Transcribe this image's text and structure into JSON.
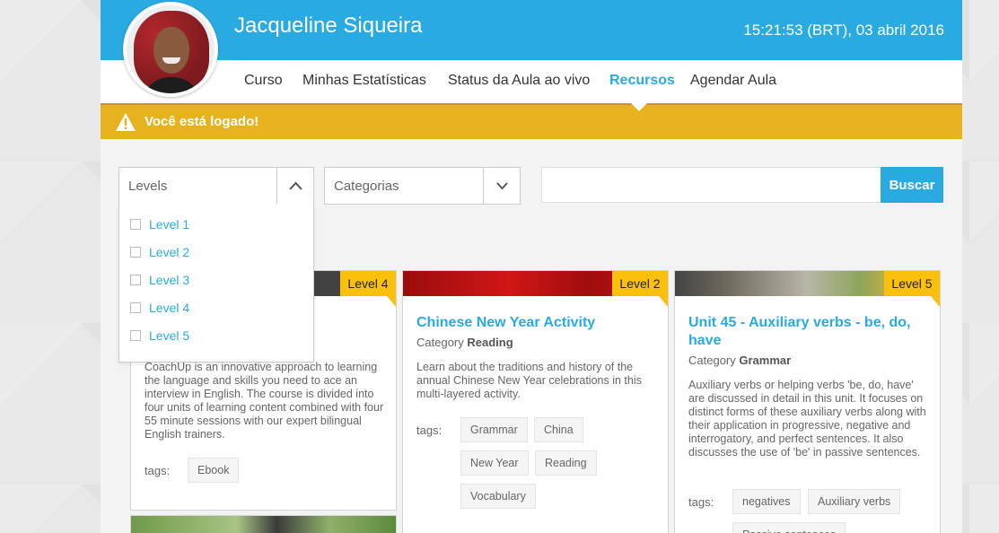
{
  "header": {
    "user_name": "Jacqueline Siqueira",
    "datetime": "15:21:53 (BRT), 03 abril 2016"
  },
  "nav": {
    "items": [
      {
        "label": "Curso"
      },
      {
        "label": "Minhas Estatísticas"
      },
      {
        "label": "Status da Aula ao vivo"
      },
      {
        "label": "Recursos",
        "active": true
      },
      {
        "label": "Agendar Aula"
      }
    ]
  },
  "alert": {
    "text": "Você está logado!"
  },
  "filters": {
    "levels_label": "Levels",
    "categories_label": "Categorias",
    "search_placeholder": "",
    "search_button": "Buscar",
    "levels_options": [
      "Level 1",
      "Level 2",
      "Level 3",
      "Level 4",
      "Level 5"
    ]
  },
  "cards": [
    {
      "level": "Level 4",
      "description": "CoachUp is an innovative approach to learning the language and skills you need to ace an interview in English. The course is divided into four units of learning content combined with four 55 minute sessions with our expert bilingual English trainers.",
      "tags_label": "tags:",
      "tags": [
        "Ebook"
      ]
    },
    {
      "level": "Level 2",
      "title": "Chinese New Year Activity",
      "category_prefix": "Category",
      "category": "Reading",
      "description": "Learn about the traditions and history of the annual Chinese New Year celebrations in this multi-layered activity.",
      "tags_label": "tags:",
      "tags": [
        "Grammar",
        "China",
        "New Year",
        "Reading",
        "Vocabulary"
      ]
    },
    {
      "level": "Level 5",
      "title": "Unit 45 - Auxiliary verbs - be, do, have",
      "category_prefix": "Category",
      "category": "Grammar",
      "description": "Auxiliary verbs or helping verbs 'be, do, have' are discussed in detail in this unit. It focuses on distinct forms of these auxiliary verbs along with their application in progressive, negative and interrogatory, and perfect sentences. It also discusses the use of 'be' in passive sentences.",
      "tags_label": "tags:",
      "tags": [
        "negatives",
        "Auxiliary verbs",
        "Passive sentences"
      ]
    }
  ],
  "colors": {
    "brand_blue": "#29abe2",
    "alert_yellow": "#e6b31e",
    "badge_yellow": "#fac00c"
  },
  "icons": {
    "alert": "warning-icon",
    "dropdown_open": "chevron-up-icon",
    "dropdown_closed": "chevron-down-icon"
  }
}
